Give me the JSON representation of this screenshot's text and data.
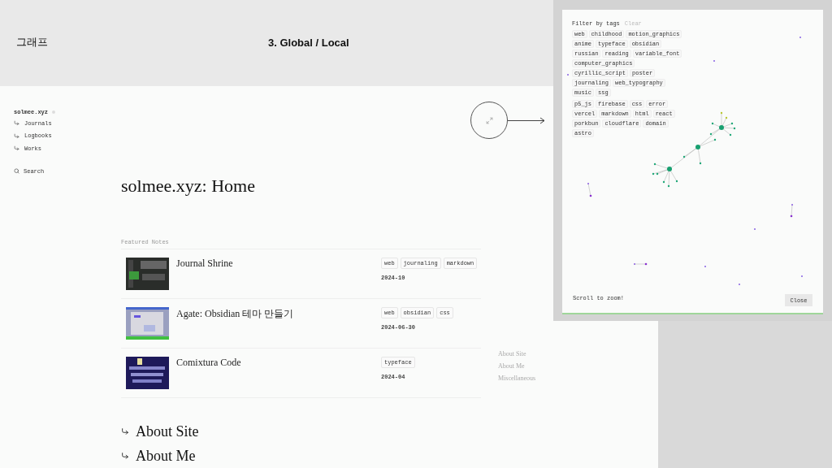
{
  "slide": {
    "title": "그래프",
    "subtitle": "3. Global / Local"
  },
  "sidebar": {
    "site_name": "solmee.xyz",
    "items": [
      "Journals",
      "Logbooks",
      "Works"
    ],
    "search": "Search"
  },
  "page": {
    "title": "solmee.xyz: Home",
    "section": "Featured Notes",
    "notes": [
      {
        "title": "Journal Shrine",
        "tags": [
          "web",
          "journaling",
          "markdown"
        ],
        "date": "2024-10"
      },
      {
        "title": "Agate: Obsidian 테마 만들기",
        "tags": [
          "web",
          "obsidian",
          "css"
        ],
        "date": "2024-06-30"
      },
      {
        "title": "Comixtura Code",
        "tags": [
          "typeface"
        ],
        "date": "2024-04"
      }
    ],
    "toc": [
      "About Site",
      "About Me",
      "Miscellaneous"
    ],
    "links": [
      "About Site",
      "About Me"
    ]
  },
  "graph_modal": {
    "filter_label": "Filter by tags",
    "clear": "Clear",
    "tag_groups": [
      [
        "web",
        "childhood",
        "motion_graphics",
        "anime",
        "typeface",
        "obsidian",
        "russian",
        "reading",
        "variable_font",
        "computer_graphics",
        "cyrillic_script",
        "poster",
        "journaling",
        "web_typography",
        "music",
        "ssg"
      ],
      [
        "p5_js",
        "firebase",
        "css",
        "error",
        "vercel",
        "markdown",
        "html",
        "react",
        "porkbun",
        "cloudflare",
        "domain",
        "astro"
      ]
    ],
    "hint": "Scroll to zoom!",
    "close": "Close"
  }
}
